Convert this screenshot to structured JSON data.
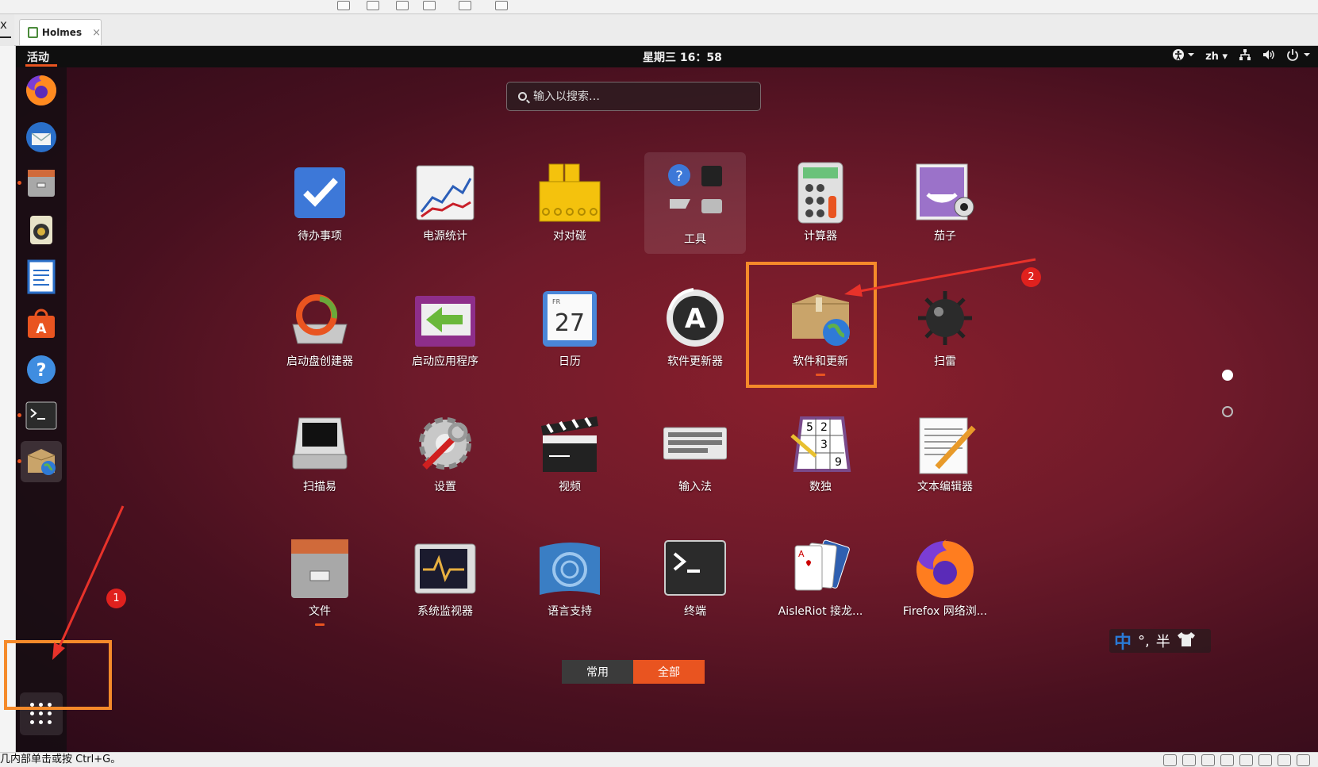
{
  "vm": {
    "tab_label": "Holmes",
    "tab_close": "×",
    "close_glyph": "x",
    "status_text": "几内部单击或按 Ctrl+G。"
  },
  "topbar": {
    "activities": "活动",
    "clock": "星期三 16：58",
    "language": "zh",
    "accessibility_icon": "accessibility-icon",
    "network_icon": "network-icon",
    "volume_icon": "volume-icon",
    "power_icon": "power-icon"
  },
  "search": {
    "placeholder": "输入以搜索…"
  },
  "dock": {
    "items": [
      {
        "icon": "firefox-icon",
        "running": false
      },
      {
        "icon": "thunderbird-icon",
        "running": false
      },
      {
        "icon": "files-icon",
        "running": true
      },
      {
        "icon": "rhythmbox-icon",
        "running": false
      },
      {
        "icon": "writer-icon",
        "running": false
      },
      {
        "icon": "software-center-icon",
        "running": false
      },
      {
        "icon": "help-icon",
        "running": false
      },
      {
        "icon": "terminal-icon",
        "running": true
      },
      {
        "icon": "software-updates-icon",
        "running": true,
        "active": true
      }
    ],
    "show_apps_icon": "show-apps-icon"
  },
  "apps": [
    {
      "label": "待办事项",
      "icon": "todo-icon"
    },
    {
      "label": "电源统计",
      "icon": "power-statistics-icon"
    },
    {
      "label": "对对碰",
      "icon": "swell-foop-icon"
    },
    {
      "label": "工具",
      "icon": "utilities-folder-icon"
    },
    {
      "label": "计算器",
      "icon": "calculator-icon"
    },
    {
      "label": "茄子",
      "icon": "cheese-icon"
    },
    {
      "label": "启动盘创建器",
      "icon": "startup-disk-creator-icon"
    },
    {
      "label": "启动应用程序",
      "icon": "startup-applications-icon"
    },
    {
      "label": "日历",
      "icon": "calendar-icon",
      "cal_day": "FR",
      "cal_date": "27"
    },
    {
      "label": "软件更新器",
      "icon": "software-updater-icon"
    },
    {
      "label": "软件和更新",
      "icon": "software-and-updates-icon"
    },
    {
      "label": "扫雷",
      "icon": "mines-icon"
    },
    {
      "label": "扫描易",
      "icon": "simple-scan-icon"
    },
    {
      "label": "设置",
      "icon": "settings-icon"
    },
    {
      "label": "视频",
      "icon": "videos-icon"
    },
    {
      "label": "输入法",
      "icon": "input-method-icon"
    },
    {
      "label": "数独",
      "icon": "sudoku-icon"
    },
    {
      "label": "文本编辑器",
      "icon": "text-editor-icon"
    },
    {
      "label": "文件",
      "icon": "files-icon"
    },
    {
      "label": "系统监视器",
      "icon": "system-monitor-icon"
    },
    {
      "label": "语言支持",
      "icon": "language-support-icon"
    },
    {
      "label": "终端",
      "icon": "terminal-icon"
    },
    {
      "label": "AisleRiot 接龙...",
      "icon": "aisleriot-icon"
    },
    {
      "label": "Firefox 网络浏...",
      "icon": "firefox-icon"
    }
  ],
  "view_switch": {
    "frequent": "常用",
    "all": "全部",
    "selected": "全部"
  },
  "ime": {
    "mode": "中",
    "punct": "°,",
    "width": "半"
  },
  "annotations": {
    "badge1": "1",
    "badge2": "2"
  },
  "colors": {
    "accent": "#e95420",
    "highlight_box": "#f58a2a",
    "badge": "#e0211e"
  }
}
